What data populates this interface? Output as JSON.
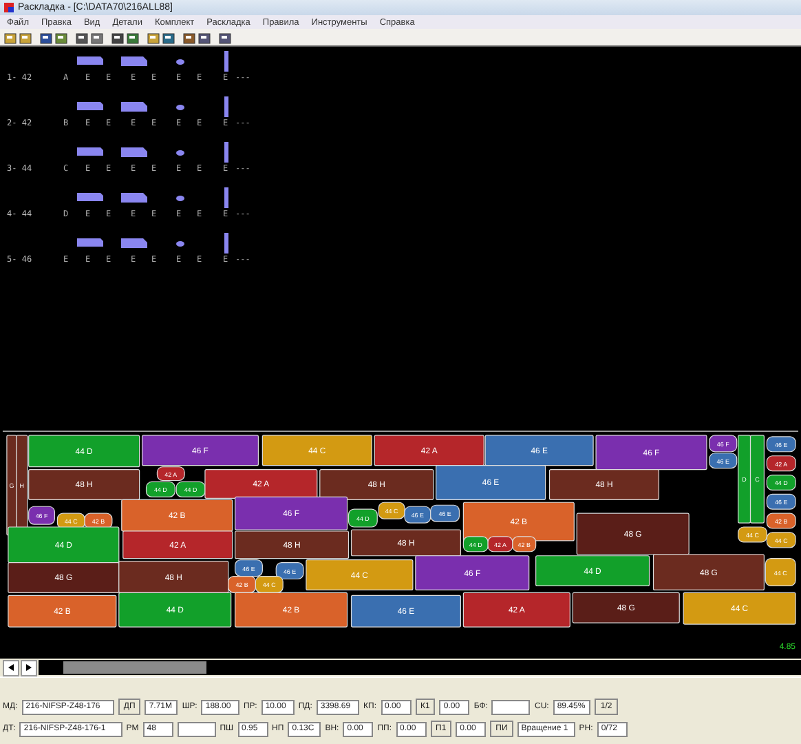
{
  "window": {
    "title": "Раскладка - [C:\\DATA70\\216ALL88]"
  },
  "menu": [
    "Файл",
    "Правка",
    "Вид",
    "Детали",
    "Комплект",
    "Раскладка",
    "Правила",
    "Инструменты",
    "Справка"
  ],
  "sets": [
    {
      "label": "1- 42",
      "codes": [
        "A",
        "E",
        "E",
        "E",
        "E",
        "E",
        "E",
        "E"
      ],
      "tail": "---"
    },
    {
      "label": "2- 42",
      "codes": [
        "B",
        "E",
        "E",
        "E",
        "E",
        "E",
        "E",
        "E"
      ],
      "tail": "---"
    },
    {
      "label": "3- 44",
      "codes": [
        "C",
        "E",
        "E",
        "E",
        "E",
        "E",
        "E",
        "E"
      ],
      "tail": "---"
    },
    {
      "label": "4- 44",
      "codes": [
        "D",
        "E",
        "E",
        "E",
        "E",
        "E",
        "E",
        "E"
      ],
      "tail": "---"
    },
    {
      "label": "5- 46",
      "codes": [
        "E",
        "E",
        "E",
        "E",
        "E",
        "E",
        "E",
        "E"
      ],
      "tail": "---"
    }
  ],
  "marker": {
    "pieces": [
      {
        "label": "G",
        "color": "#6b2b1f"
      },
      {
        "label": "H",
        "color": "#6b2b1f"
      },
      {
        "label": "44 D",
        "color": "#12a02a"
      },
      {
        "label": "46 F",
        "color": "#7a2fae"
      },
      {
        "label": "44 C",
        "color": "#d39a12"
      },
      {
        "label": "42 A",
        "color": "#b5262a"
      },
      {
        "label": "46 E",
        "color": "#3a6fb0"
      },
      {
        "label": "46 F",
        "color": "#7a2fae"
      },
      {
        "label": "46 F",
        "color": "#7a2fae"
      },
      {
        "label": "46 E",
        "color": "#3a6fb0"
      },
      {
        "label": "D",
        "color": "#12a02a"
      },
      {
        "label": "C",
        "color": "#12a02a"
      },
      {
        "label": "46 E",
        "color": "#3a6fb0"
      },
      {
        "label": "42 A",
        "color": "#b5262a"
      },
      {
        "label": "44 D",
        "color": "#12a02a"
      },
      {
        "label": "46 E",
        "color": "#3a6fb0"
      },
      {
        "label": "42 B",
        "color": "#d9622a"
      },
      {
        "label": "48 H",
        "color": "#6b2b1f"
      },
      {
        "label": "42 A",
        "color": "#b5262a"
      },
      {
        "label": "44 D",
        "color": "#12a02a"
      },
      {
        "label": "44 D",
        "color": "#12a02a"
      },
      {
        "label": "42 A",
        "color": "#b5262a"
      },
      {
        "label": "48 H",
        "color": "#6b2b1f"
      },
      {
        "label": "46 E",
        "color": "#3a6fb0"
      },
      {
        "label": "48 H",
        "color": "#6b2b1f"
      },
      {
        "label": "46 F",
        "color": "#7a2fae"
      },
      {
        "label": "44 C",
        "color": "#d39a12"
      },
      {
        "label": "42 B",
        "color": "#d9622a"
      },
      {
        "label": "42 B",
        "color": "#d9622a"
      },
      {
        "label": "46 F",
        "color": "#7a2fae"
      },
      {
        "label": "44 D",
        "color": "#12a02a"
      },
      {
        "label": "44 C",
        "color": "#d39a12"
      },
      {
        "label": "46 E",
        "color": "#3a6fb0"
      },
      {
        "label": "46 E",
        "color": "#3a6fb0"
      },
      {
        "label": "42 B",
        "color": "#d9622a"
      },
      {
        "label": "48 G",
        "color": "#5a1e18"
      },
      {
        "label": "44 C",
        "color": "#d39a12"
      },
      {
        "label": "44 D",
        "color": "#12a02a"
      },
      {
        "label": "42 A",
        "color": "#b5262a"
      },
      {
        "label": "48 H",
        "color": "#6b2b1f"
      },
      {
        "label": "48 H",
        "color": "#6b2b1f"
      },
      {
        "label": "44 D",
        "color": "#12a02a"
      },
      {
        "label": "42 A",
        "color": "#b5262a"
      },
      {
        "label": "42 B",
        "color": "#d9622a"
      },
      {
        "label": "44 C",
        "color": "#d39a12"
      },
      {
        "label": "48 G",
        "color": "#5a1e18"
      },
      {
        "label": "48 H",
        "color": "#6b2b1f"
      },
      {
        "label": "46 E",
        "color": "#3a6fb0"
      },
      {
        "label": "46 E",
        "color": "#3a6fb0"
      },
      {
        "label": "42 B",
        "color": "#d9622a"
      },
      {
        "label": "44 C",
        "color": "#d39a12"
      },
      {
        "label": "44 C",
        "color": "#d39a12"
      },
      {
        "label": "46 F",
        "color": "#7a2fae"
      },
      {
        "label": "44 D",
        "color": "#12a02a"
      },
      {
        "label": "48 G",
        "color": "#6b2b1f"
      },
      {
        "label": "44 C",
        "color": "#d39a12"
      },
      {
        "label": "42 B",
        "color": "#d9622a"
      },
      {
        "label": "44 D",
        "color": "#12a02a"
      },
      {
        "label": "42 B",
        "color": "#d9622a"
      },
      {
        "label": "46 E",
        "color": "#3a6fb0"
      },
      {
        "label": "42 A",
        "color": "#b5262a"
      },
      {
        "label": "48 G",
        "color": "#5a1e18"
      },
      {
        "label": "44 C",
        "color": "#d39a12"
      }
    ],
    "length": "4.85"
  },
  "fields": [
    [
      {
        "kind": "field",
        "label": "МД:",
        "value": "216-NIFSP-Z48-176"
      },
      {
        "kind": "button",
        "label": "ДП"
      },
      {
        "kind": "field",
        "value": "7.71M"
      },
      {
        "kind": "field",
        "label": "ШР:",
        "value": "188.00"
      },
      {
        "kind": "field",
        "label": "ПР:",
        "value": "10.00"
      },
      {
        "kind": "field",
        "label": "ПД:",
        "value": "3398.69"
      },
      {
        "kind": "field",
        "label": "КП:",
        "value": "0.00"
      },
      {
        "kind": "button",
        "label": "К1"
      },
      {
        "kind": "field",
        "value": "0.00"
      },
      {
        "kind": "field",
        "label": "БФ:"
      },
      {
        "kind": "field",
        "label": "CU:",
        "value": "89.45%"
      },
      {
        "kind": "button",
        "label": "1/2"
      }
    ],
    [
      {
        "kind": "field",
        "label": "ДТ:",
        "value": "216-NIFSP-Z48-176-1"
      },
      {
        "kind": "field",
        "label": "РМ",
        "value": "48"
      },
      {
        "kind": "field"
      },
      {
        "kind": "field",
        "label": "ПШ",
        "value": "0.95"
      },
      {
        "kind": "field",
        "label": "НП",
        "value": "0.13C"
      },
      {
        "kind": "field",
        "label": "ВН:",
        "value": "0.00"
      },
      {
        "kind": "field",
        "label": "ПП:",
        "value": "0.00"
      },
      {
        "kind": "button",
        "label": "П1"
      },
      {
        "kind": "field",
        "value": "0.00"
      },
      {
        "kind": "button",
        "label": "ПИ"
      },
      {
        "kind": "field",
        "value": "Вращение 1"
      },
      {
        "kind": "field",
        "label": "РН:",
        "value": "0/72"
      }
    ]
  ]
}
